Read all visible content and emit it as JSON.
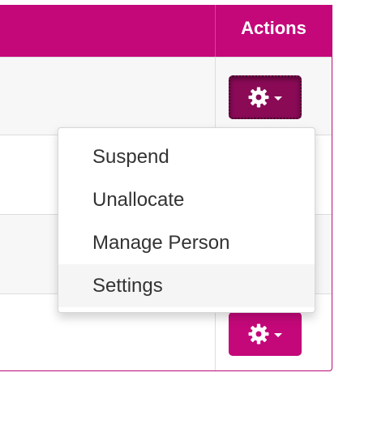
{
  "table": {
    "header": {
      "actions_label": "Actions"
    }
  },
  "dropdown": {
    "items": [
      {
        "label": "Suspend"
      },
      {
        "label": "Unallocate"
      },
      {
        "label": "Manage Person"
      },
      {
        "label": "Settings"
      }
    ],
    "hovered_item": "Settings"
  },
  "icons": {
    "action_button": "gear-icon",
    "dropdown_indicator": "caret-down-icon"
  },
  "colors": {
    "brand": "#c4087a",
    "active_button": "#8a0a56",
    "row_stripe": "#f7f7f7",
    "menu_hover": "#f5f5f5",
    "menu_text": "#333333"
  }
}
